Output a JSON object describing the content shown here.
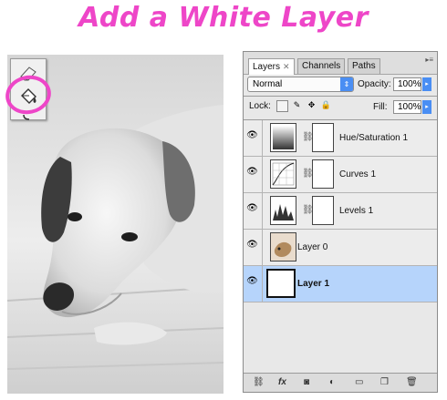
{
  "header": {
    "title": "Add a White Layer"
  },
  "colors": {
    "accent": "#ee46c8",
    "selection": "#b6d4fb",
    "blue_control": "#4a8ef3"
  },
  "toolbox": {
    "tools": [
      {
        "name": "eraser",
        "icon": "eraser-icon"
      },
      {
        "name": "paint bucket",
        "icon": "paint-bucket-icon"
      }
    ]
  },
  "panel": {
    "tabs": [
      {
        "label": "Layers",
        "active": true,
        "closable": true
      },
      {
        "label": "Channels",
        "active": false
      },
      {
        "label": "Paths",
        "active": false
      }
    ],
    "blend_mode": "Normal",
    "opacity_label": "Opacity:",
    "opacity_value": "100%",
    "lock_label": "Lock:",
    "fill_label": "Fill:",
    "fill_value": "100%",
    "layers": [
      {
        "name": "Hue/Saturation 1",
        "type": "adjustment",
        "visible": true,
        "selected": false
      },
      {
        "name": "Curves 1",
        "type": "adjustment",
        "visible": true,
        "selected": false
      },
      {
        "name": "Levels 1",
        "type": "adjustment",
        "visible": true,
        "selected": false
      },
      {
        "name": "Layer 0",
        "type": "image",
        "visible": true,
        "selected": false
      },
      {
        "name": "Layer 1",
        "type": "white-fill",
        "visible": true,
        "selected": true
      }
    ],
    "bottom_icons": [
      "link-icon",
      "fx-icon",
      "mask-icon",
      "adjustment-icon",
      "group-folder-icon",
      "new-layer-icon",
      "trash-icon"
    ]
  }
}
